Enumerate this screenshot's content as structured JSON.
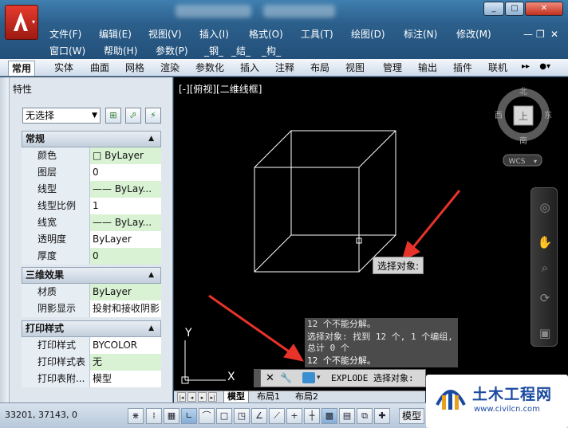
{
  "window": {
    "controls": {
      "minimize": "_",
      "maximize": "□",
      "close": "✕"
    },
    "mdi_controls": {
      "minimize": "—",
      "restore": "❐",
      "close": "✕"
    }
  },
  "menu": {
    "row1": [
      "文件(F)",
      "编辑(E)",
      "视图(V)",
      "插入(I)",
      "格式(O)",
      "工具(T)",
      "绘图(D)",
      "标注(N)",
      "修改(M)"
    ],
    "row2": [
      "窗口(W)",
      "帮助(H)",
      "参数(P)",
      "_钢_",
      "_结_",
      "_构_"
    ]
  },
  "ribbon": {
    "tabs": [
      "常用",
      "实体",
      "曲面",
      "网格",
      "渲染",
      "参数化",
      "插入",
      "注释",
      "布局",
      "视图",
      "管理",
      "输出",
      "插件",
      "联机"
    ],
    "active_tab": "常用",
    "overflow": "▸▸"
  },
  "properties_palette": {
    "title": "特性",
    "selection": "无选择",
    "sections": [
      {
        "name": "常规",
        "rows": [
          {
            "label": "颜色",
            "value": "□ ByLayer",
            "highlight": true
          },
          {
            "label": "图层",
            "value": "0",
            "highlight": false
          },
          {
            "label": "线型",
            "value": "—— ByLay...",
            "highlight": true
          },
          {
            "label": "线型比例",
            "value": "1",
            "highlight": false
          },
          {
            "label": "线宽",
            "value": "—— ByLay...",
            "highlight": true
          },
          {
            "label": "透明度",
            "value": "ByLayer",
            "highlight": false
          },
          {
            "label": "厚度",
            "value": "0",
            "highlight": true
          }
        ]
      },
      {
        "name": "三维效果",
        "rows": [
          {
            "label": "材质",
            "value": "ByLayer",
            "highlight": true
          },
          {
            "label": "阴影显示",
            "value": "投射和接收阴影",
            "highlight": false
          }
        ]
      },
      {
        "name": "打印样式",
        "rows": [
          {
            "label": "打印样式",
            "value": "BYCOLOR",
            "highlight": false
          },
          {
            "label": "打印样式表",
            "value": "无",
            "highlight": true
          },
          {
            "label": "打印表附...",
            "value": "模型",
            "highlight": false
          }
        ]
      }
    ]
  },
  "viewport": {
    "label": "[-][俯视][二维线框]",
    "tooltip": "选择对象:",
    "viewcube": {
      "north": "北",
      "south": "南",
      "west": "西",
      "east": "东",
      "face": "上",
      "ucs": "WCS"
    },
    "ucs_axis": {
      "x": "X",
      "y": "Y"
    }
  },
  "command": {
    "history": [
      "12 个不能分解。",
      "选择对象: 找到 12 个, 1 个编组, 总计 0 个",
      "12 个不能分解。"
    ],
    "prompt": "EXPLODE 选择对象:"
  },
  "layout_tabs": [
    "模型",
    "布局1",
    "布局2"
  ],
  "status": {
    "coords": "33201, 37143, 0",
    "model_label": "模型"
  },
  "watermark": {
    "name": "土木工程网",
    "url": "www.civilcn.com"
  },
  "colors": {
    "title_blue": "#2c5f8b",
    "highlight_green": "#d9f2d4",
    "arrow_red": "#e8332a"
  }
}
